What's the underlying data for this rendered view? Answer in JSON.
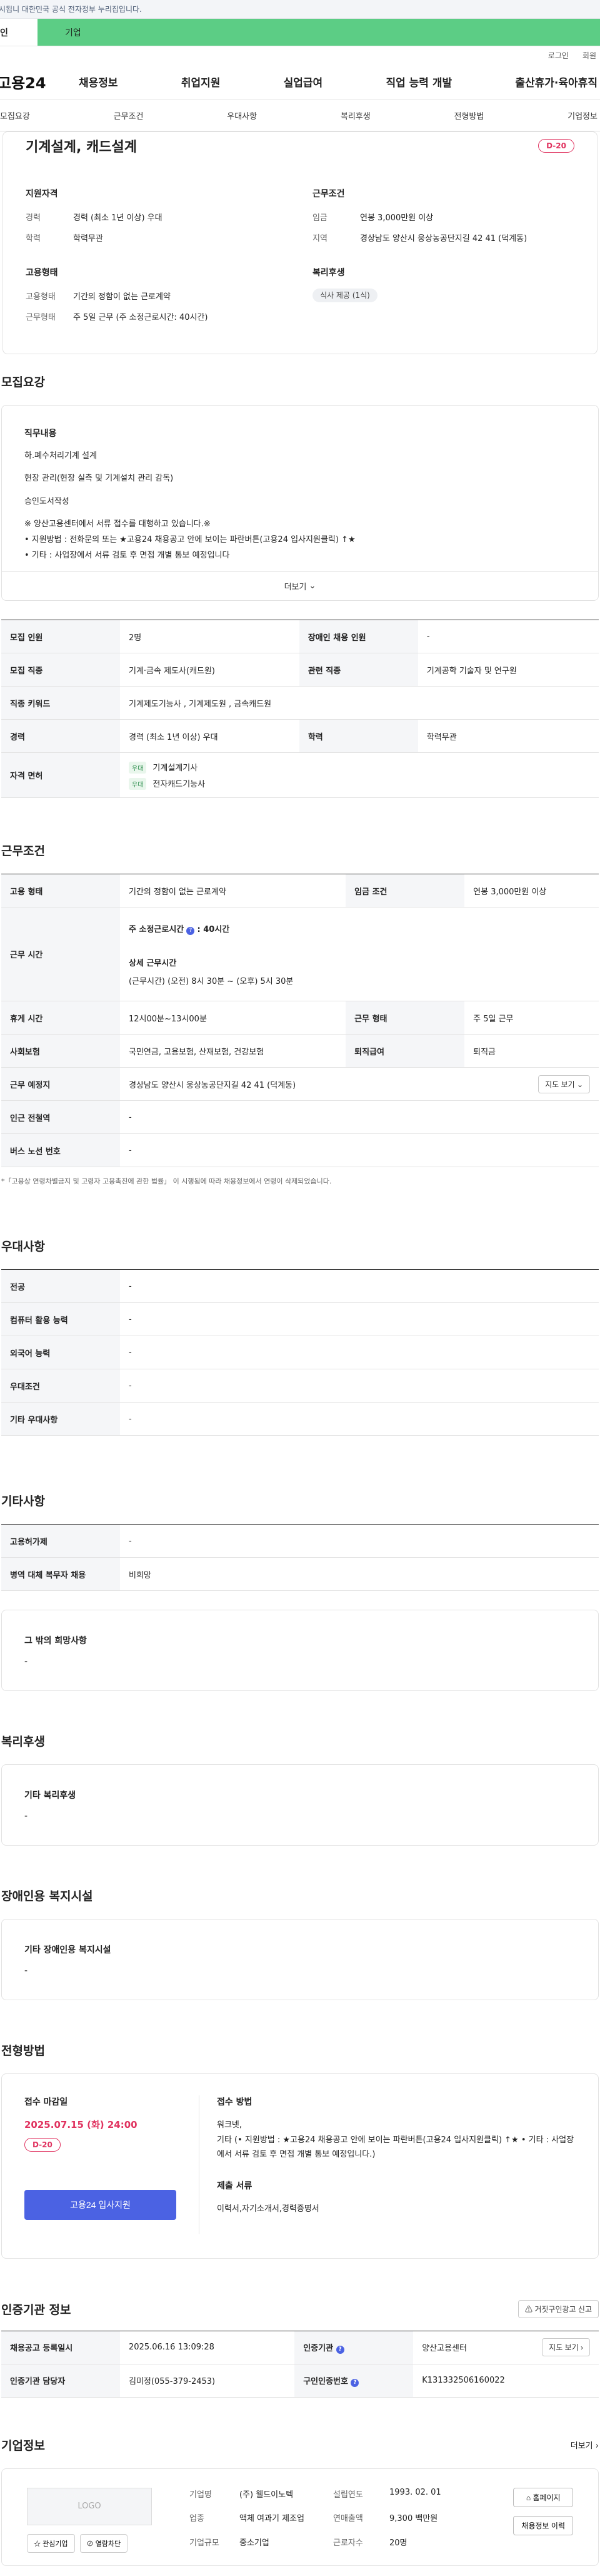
{
  "gov_banner": "시됩니 대한민국 공식 전자정부 누리집입니다.",
  "tabs": {
    "individual": "인",
    "company": "기업"
  },
  "util": {
    "login": "로그인",
    "join": "회원"
  },
  "header": {
    "logo": "고용24",
    "nav": [
      "채용정보",
      "취업지원",
      "실업급여",
      "직업 능력 개발",
      "출산휴가·육아휴직"
    ]
  },
  "anchors": [
    "모집요강",
    "근무조건",
    "우대사항",
    "복리후생",
    "전형방법",
    "기업정보"
  ],
  "summary": {
    "title": "기계설계, 캐드설계",
    "dday": "D-20",
    "qual_title": "지원자격",
    "qual_rows": [
      {
        "k": "경력",
        "v": "경력 (최소 1년 이상) 우대"
      },
      {
        "k": "학력",
        "v": "학력무관"
      }
    ],
    "cond_title": "근무조건",
    "cond_rows": [
      {
        "k": "임금",
        "v": "연봉 3,000만원 이상"
      },
      {
        "k": "지역",
        "v": "경상남도 양산시 웅상농공단지길 42 41 (덕계동)"
      }
    ],
    "emp_title": "고용형태",
    "emp_rows": [
      {
        "k": "고용형태",
        "v": "기간의 정함이 없는 근로계약"
      },
      {
        "k": "근무형태",
        "v": "주 5일 근무 (주 소정근로시간: 40시간)"
      }
    ],
    "welfare_title": "복리후생",
    "welfare_chip": "식사 제공 (1식)"
  },
  "recruit": {
    "title": "모집요강",
    "box_title": "직무내용",
    "lines": [
      "하.폐수처리기계 설계",
      "현장 관리(현장 실측 및 기계설치 관리 감독)",
      "승인도서작성",
      "※ 양산고용센터에서 서류 접수를 대행하고 있습니다.※"
    ],
    "small1": "• 지원방법 : 전화문의 또는 ★고용24 채용공고 안에 보이는 파란버튼(고용24 입사지원클릭) ↑★",
    "small2": "• 기타 : 사업장에서 서류 검토 후 면접 개별 통보 예정입니다",
    "more": "더보기",
    "table": {
      "r1": [
        "모집 인원",
        "2명",
        "장애인 채용 인원",
        "-"
      ],
      "r2": [
        "모집 직종",
        "기계·금속 제도사(캐드원)",
        "관련 직종",
        "기계공학 기술자 및 연구원"
      ],
      "r3": [
        "직종 키워드",
        "기계제도기능사 , 기계제도원 , 금속캐드원"
      ],
      "r4": [
        "경력",
        "경력 (최소 1년 이상) 우대",
        "학력",
        "학력무관"
      ],
      "r5_h": "자격 면허",
      "tag": "우대",
      "lic1": "기계설계기사",
      "lic2": "전자캐드기능사"
    }
  },
  "work": {
    "title": "근무조건",
    "r1": [
      "고용 형태",
      "기간의 정함이 없는 근로계약",
      "임금 조건",
      "연봉 3,000만원 이상"
    ],
    "r2_h": "근무 시간",
    "hours_title": "주 소정근로시간",
    "hours_val": ": 40시간",
    "detail_title": "상세 근무시간",
    "detail_val": "(근무시간) (오전) 8시 30분 ~ (오후) 5시 30분",
    "r3": [
      "휴게 시간",
      "12시00분~13시00분",
      "근무 형태",
      "주 5일 근무"
    ],
    "r4": [
      "사회보험",
      "국민연금, 고용보험, 산재보험, 건강보험",
      "퇴직급여",
      "퇴직금"
    ],
    "r5": [
      "근무 예정지",
      "경상남도 양산시 웅상농공단지길 42 41 (덕계동)"
    ],
    "map_btn": "지도 보기",
    "r6": [
      "인근 전철역",
      "-"
    ],
    "r7": [
      "버스 노선 번호",
      "-"
    ],
    "note": "*「고용상 연령차별금지 및 고령자 고용촉진에 관한 법률」 이 시행됨에 따라 채용정보에서 연령이 삭제되었습니다."
  },
  "pref": {
    "title": "우대사항",
    "rows": [
      [
        "전공",
        "-"
      ],
      [
        "컴퓨터 활용 능력",
        "-"
      ],
      [
        "외국어 능력",
        "-"
      ],
      [
        "우대조건",
        "-"
      ],
      [
        "기타 우대사항",
        "-"
      ]
    ]
  },
  "etc": {
    "title": "기타사항",
    "rows": [
      [
        "고용허가제",
        "-"
      ],
      [
        "병역 대체 복무자 채용",
        "비희망"
      ]
    ],
    "box_title": "그 밖의 희망사항",
    "box_val": "-"
  },
  "welfare": {
    "title": "복리후생",
    "box_title": "기타 복리후생",
    "box_val": "-"
  },
  "disabled": {
    "title": "장애인용 복지시설",
    "box_title": "기타 장애인용 복지시설",
    "box_val": "-"
  },
  "process": {
    "title": "전형방법",
    "deadline_title": "접수 마감일",
    "deadline": "2025.07.15 (화) 24:00",
    "dday": "D-20",
    "apply_btn": "고용24 입사지원",
    "method_title": "접수 방법",
    "method_val": "워크넷,\n기타 (• 지원방법 : ★고용24 채용공고 안에 보이는 파란버튼(고용24 입사지원클릭) ↑★ • 기타 : 사업장에서 서류 검토 후 면접 개별 통보 예정입니다.)",
    "docs_title": "제출 서류",
    "docs_val": "이력서,자기소개서,경력증명서"
  },
  "cert": {
    "title": "인증기관 정보",
    "report_btn": "거짓구인광고 신고",
    "r1": [
      "채용공고 등록일시",
      "2025.06.16 13:09:28",
      "인증기관",
      "양산고용센터"
    ],
    "map_btn": "지도 보기",
    "r2": [
      "인증기관 담당자",
      "김미정(055-379-2453)",
      "구인인증번호",
      "K131332506160022"
    ]
  },
  "company": {
    "title": "기업정보",
    "more": "더보기",
    "logo": "LOGO",
    "fav_btn": "관심기업",
    "block_btn": "열람차단",
    "info": [
      [
        "기업명",
        "(주) 웰드이노텍",
        "설립연도",
        "1993. 02. 01"
      ],
      [
        "업종",
        "액체 여과기 제조업",
        "연매출액",
        "9,300 백만원"
      ],
      [
        "기업규모",
        "중소기업",
        "근로자수",
        "20명"
      ]
    ],
    "home_btn": "홈페이지",
    "hist_btn": "채용정보 이력"
  }
}
